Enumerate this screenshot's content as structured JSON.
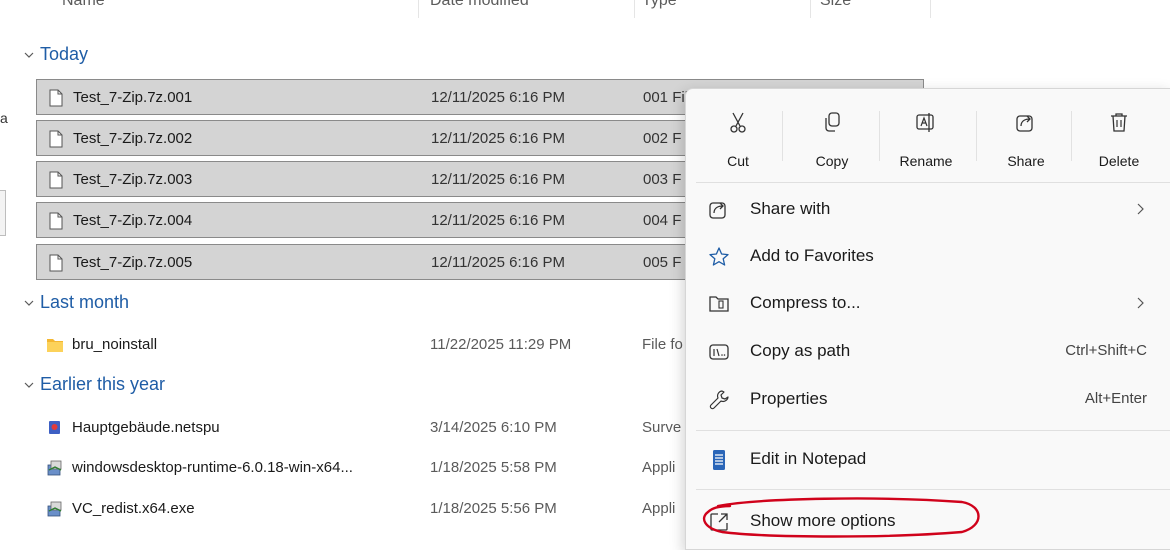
{
  "columns": [
    "Name",
    "Date modified",
    "Type",
    "Size"
  ],
  "edge_letter": "a",
  "groups": {
    "today": "Today",
    "last_month": "Last month",
    "earlier": "Earlier this year"
  },
  "files_today": [
    {
      "name": "Test_7-Zip.7z.001",
      "date": "12/11/2025 6:16 PM",
      "type": "001 File"
    },
    {
      "name": "Test_7-Zip.7z.002",
      "date": "12/11/2025 6:16 PM",
      "type": "002 F"
    },
    {
      "name": "Test_7-Zip.7z.003",
      "date": "12/11/2025 6:16 PM",
      "type": "003 F"
    },
    {
      "name": "Test_7-Zip.7z.004",
      "date": "12/11/2025 6:16 PM",
      "type": "004 F"
    },
    {
      "name": "Test_7-Zip.7z.005",
      "date": "12/11/2025 6:16 PM",
      "type": "005 F"
    }
  ],
  "files_last_month": [
    {
      "name": "bru_noinstall",
      "date": "11/22/2025 11:29 PM",
      "type": "File fo"
    }
  ],
  "files_earlier": [
    {
      "name": "Hauptgebäude.netspu",
      "date": "3/14/2025 6:10 PM",
      "type": "Surve"
    },
    {
      "name": "windowsdesktop-runtime-6.0.18-win-x64...",
      "date": "1/18/2025 5:58 PM",
      "type": "Appli"
    },
    {
      "name": "VC_redist.x64.exe",
      "date": "1/18/2025 5:56 PM",
      "type": "Appli"
    }
  ],
  "menu": {
    "quick_actions": [
      "Cut",
      "Copy",
      "Rename",
      "Share",
      "Delete"
    ],
    "share_with": "Share with",
    "add_favorites": "Add to Favorites",
    "compress": "Compress to...",
    "copy_path": "Copy as path",
    "copy_path_shortcut": "Ctrl+Shift+C",
    "properties": "Properties",
    "properties_shortcut": "Alt+Enter",
    "edit_notepad": "Edit in Notepad",
    "show_more": "Show more options"
  },
  "colors": {
    "group_header": "#1f5da6",
    "selection": "#d4d4d4",
    "highlight_circle": "#d0021b"
  }
}
